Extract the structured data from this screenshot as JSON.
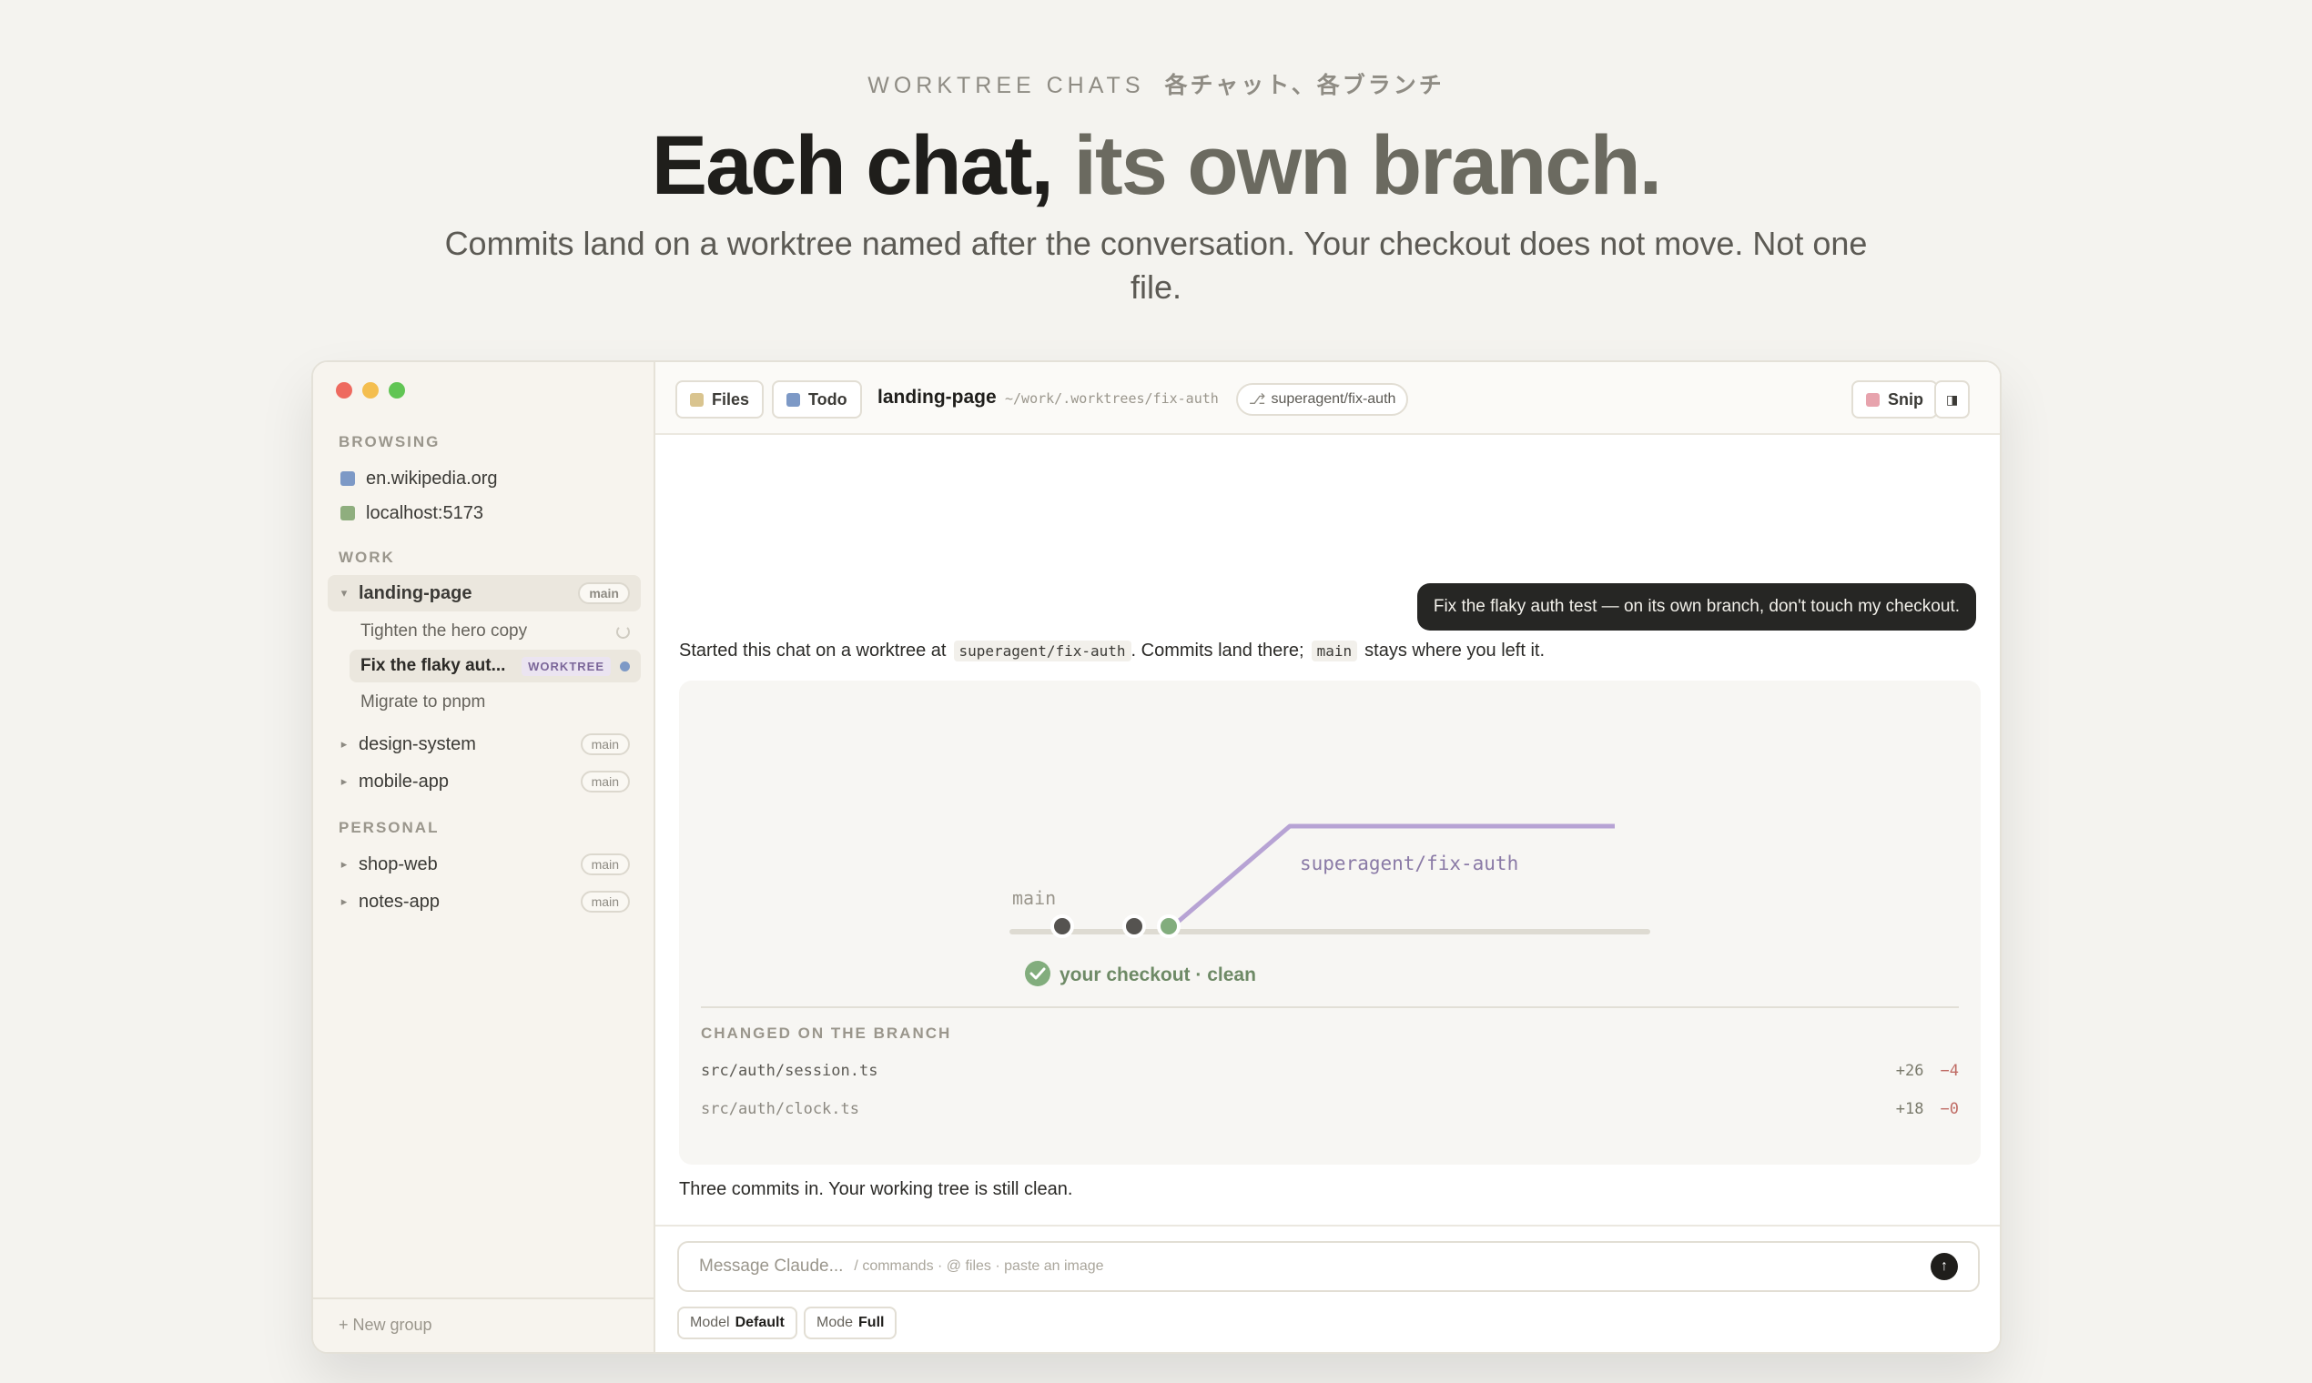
{
  "hero": {
    "eyebrow": "WORKTREE CHATS",
    "eyebrow_jp": "各チャット、各ブランチ",
    "headline_a": "Each chat,",
    "headline_b": "its own branch.",
    "subhead": "Commits land on a worktree named after the conversation. Your checkout does not move. Not one file."
  },
  "sidebar": {
    "browsing_label": "BROWSING",
    "browsing": [
      {
        "label": "en.wikipedia.org",
        "color": "#7d99c6"
      },
      {
        "label": "localhost:5173",
        "color": "#8fae7e"
      }
    ],
    "work_label": "WORK",
    "work": [
      {
        "label": "landing-page",
        "branch": "main",
        "caret": "▾"
      },
      {
        "label": "design-system",
        "branch": "main",
        "caret": "▸"
      },
      {
        "label": "mobile-app",
        "branch": "main",
        "caret": "▸"
      }
    ],
    "chats": [
      {
        "label": "Tighten the hero copy"
      },
      {
        "label": "Fix the flaky aut...",
        "badge": "WORKTREE"
      },
      {
        "label": "Migrate to pnpm"
      }
    ],
    "personal_label": "PERSONAL",
    "personal": [
      {
        "label": "shop-web",
        "branch": "main",
        "caret": "▸"
      },
      {
        "label": "notes-app",
        "branch": "main",
        "caret": "▸"
      }
    ],
    "new_group": "+ New group"
  },
  "topbar": {
    "files": "Files",
    "todo": "Todo",
    "project": "landing-page",
    "path": "~/work/.worktrees/fix-auth",
    "branch": "superagent/fix-auth",
    "snip": "Snip",
    "panel_icon": "◨"
  },
  "chat": {
    "user_message": "Fix the flaky auth test — on its own branch, don't touch my checkout.",
    "assist_a": "Started this chat on a worktree at",
    "assist_code1": "superagent/fix-auth",
    "assist_b": ". Commits land there;",
    "assist_code2": "main",
    "assist_c": "stays where you left it.",
    "closing": "Three commits in. Your working tree is still clean."
  },
  "graph": {
    "main_label": "main",
    "branch_label": "superagent/fix-auth",
    "checkout_label": "your checkout · clean",
    "branch_color": "#b7a3d4",
    "main_color": "#dedbd2",
    "check_color": "#82ad7d"
  },
  "changes": {
    "label": "CHANGED ON THE BRANCH",
    "files": [
      {
        "path": "src/auth/session.ts",
        "add": "+26",
        "del": "−4"
      },
      {
        "path": "src/auth/clock.ts",
        "add": "+18",
        "del": "−0"
      }
    ]
  },
  "composer": {
    "placeholder": "Message Claude...",
    "hint": "/ commands · @ files · paste an image",
    "send_icon": "↑",
    "model_key": "Model",
    "model_val": "Default",
    "mode_key": "Mode",
    "mode_val": "Full"
  }
}
